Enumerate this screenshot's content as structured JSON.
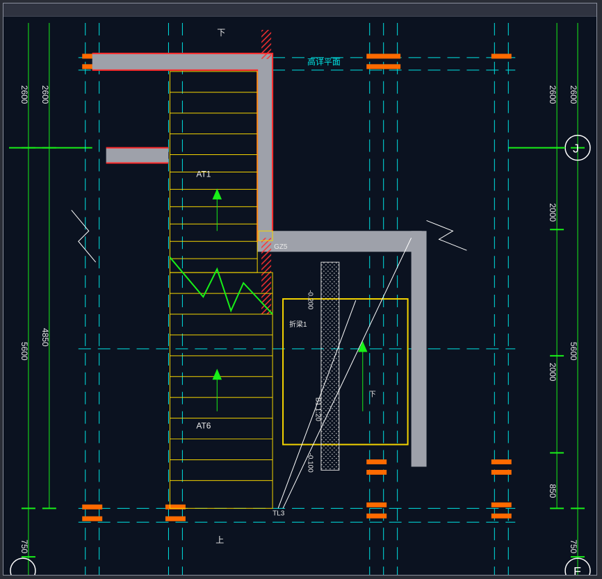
{
  "dims": {
    "left_outer_top": "2600",
    "left_outer_mid": "5600",
    "left_outer_bot": "750",
    "left_inner_top": "2600",
    "left_inner_mid": "4850",
    "right_outer_top": "2600",
    "right_outer_mid": "5600",
    "right_outer_bot": "750",
    "right_inner_top": "2600",
    "right_inner_upper": "2000",
    "right_inner_mid": "2000",
    "right_inner_lower": "850"
  },
  "labels": {
    "down": "下",
    "up": "上",
    "platform": "高详平面",
    "at1": "AT1",
    "at6": "AT6",
    "gz5": "GZ5",
    "zheliang1": "折梁1",
    "tl3": "TL3",
    "slope": "B1 1:20",
    "elev_top": "-0.200",
    "elev_bot": "-0.100"
  },
  "grid": {
    "j": "J",
    "f": "F"
  }
}
